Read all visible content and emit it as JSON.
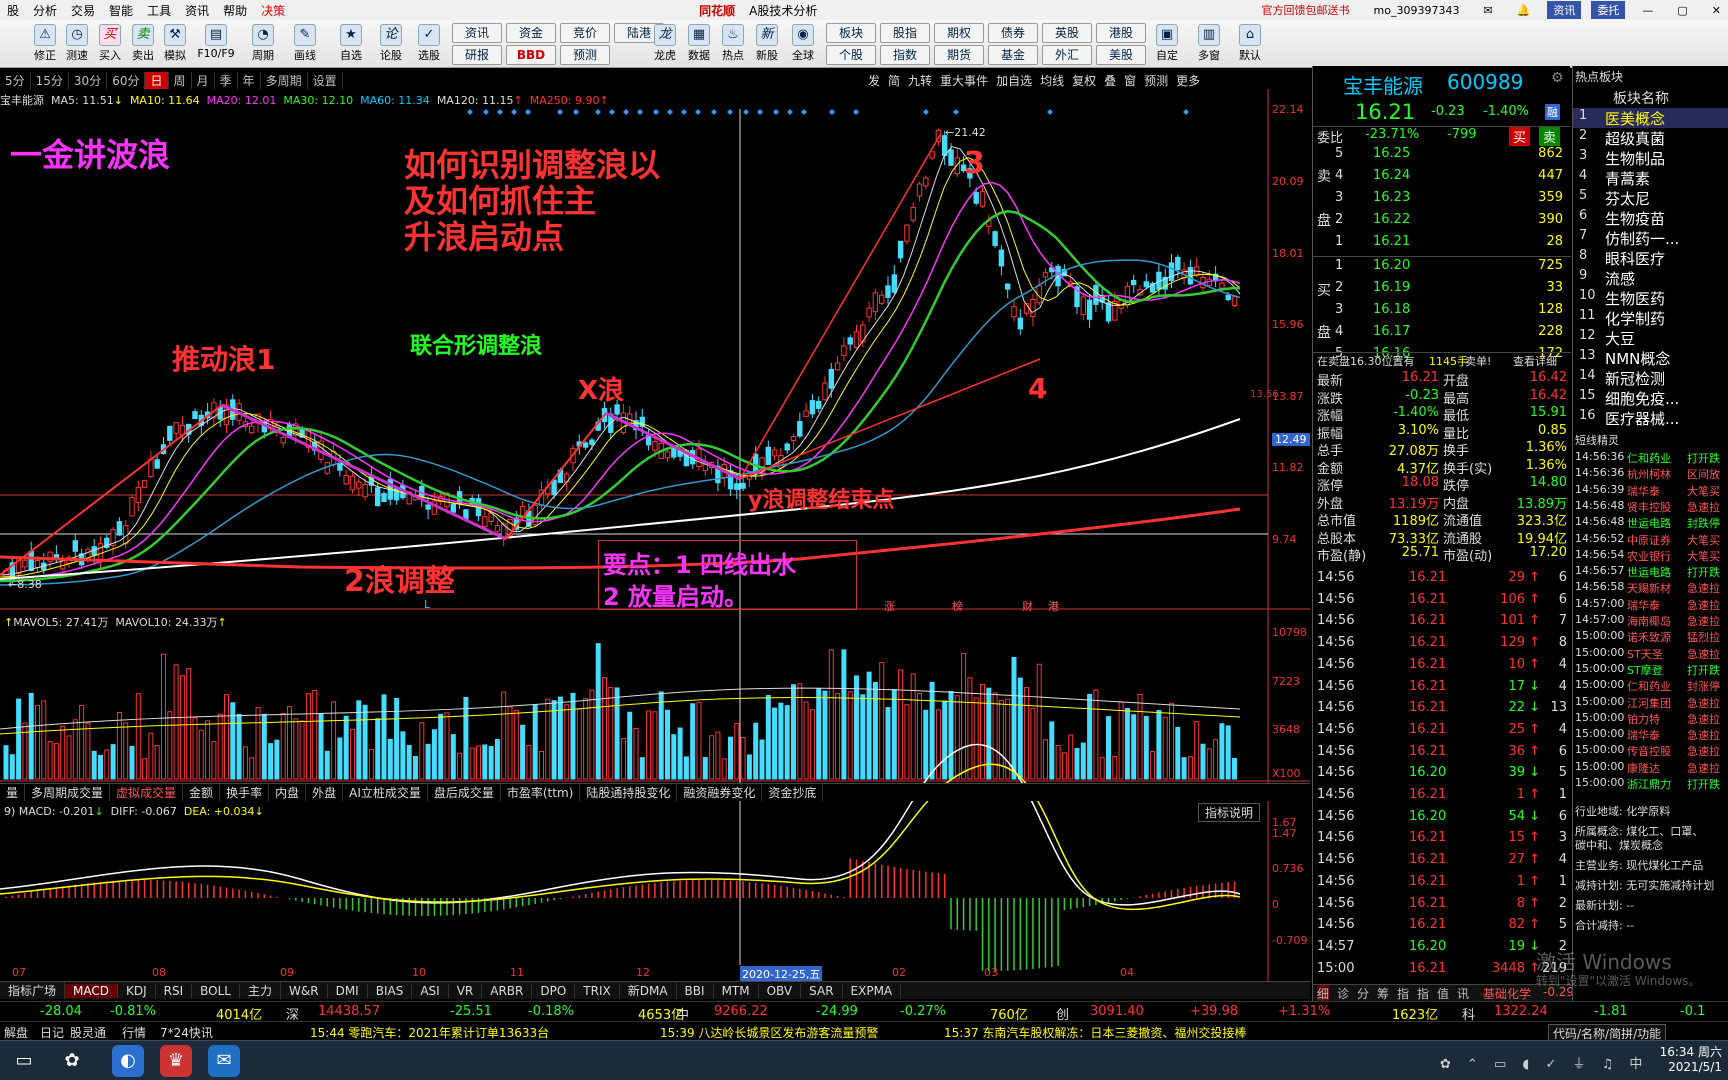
{
  "menu": {
    "items": [
      "股",
      "分析",
      "交易",
      "智能",
      "工具",
      "资讯",
      "帮助",
      "决策"
    ],
    "logo": "同花顺",
    "app_title": "A股技术分析",
    "promo": "官方回馈包邮送书",
    "user": "mo_309397343",
    "zixun": "资讯",
    "weituo": "委托"
  },
  "toolbar": {
    "icons": [
      "修正",
      "测速",
      "买入",
      "卖出",
      "模拟",
      "F10/F9",
      "周期",
      "画线",
      "自选",
      "论股",
      "选股"
    ],
    "grid1": [
      "资讯",
      "资金",
      "竞价",
      "陆港",
      "研报",
      "BBD",
      "预测"
    ],
    "icons2": [
      "龙虎",
      "数据",
      "热点",
      "新股",
      "全球"
    ],
    "grid2": [
      "板块",
      "股指",
      "期权",
      "债券",
      "英股",
      "港股",
      "个股",
      "指数",
      "期货",
      "基金",
      "外汇",
      "美股"
    ],
    "icons3": [
      "自定",
      "多窗",
      "默认"
    ]
  },
  "periods": [
    "5分",
    "15分",
    "30分",
    "60分",
    "日",
    "周",
    "月",
    "季",
    "年",
    "多周期",
    "设置"
  ],
  "period_selected": "日",
  "chart_tools": [
    "发",
    "简",
    "九转",
    "重大事件",
    "加自选",
    "均线",
    "复权",
    "叠",
    "窗",
    "预测",
    "更多"
  ],
  "ma": {
    "name": "宝丰能源",
    "ma5": "MA5: 11.51",
    "ma10": "MA10: 11.64",
    "ma20": "MA20: 12.01",
    "ma30": "MA30: 12.10",
    "ma60": "MA60: 11.34",
    "ma120": "MA120: 11.15",
    "ma250": "MA250: 9.90"
  },
  "price_axis": [
    "22.14",
    "20.09",
    "18.01",
    "15.96",
    "13.87",
    "11.82",
    "9.74"
  ],
  "price_tags": {
    "cur": "12.49",
    "line": "13.56",
    "high": "21.42",
    "low": "8.38"
  },
  "annotations": {
    "title": "一金讲波浪",
    "q1": "如何识别调整浪以",
    "q2": "及如何抓住主",
    "q3": "升浪启动点",
    "w1": "推动浪1",
    "w2": "2浪调整",
    "wx": "X浪",
    "combo": "联合形调整浪",
    "w3": "3",
    "w4": "4",
    "end": "y浪调整结束点",
    "kp1": "要点：1 四线出水",
    "kp2": "2 放量启动。",
    "l": "L",
    "marks": [
      "涨",
      "榜",
      "财",
      "港"
    ]
  },
  "vol": {
    "mavol5": "MAVOL5: 27.41万",
    "mavol10": "MAVOL10: 24.33万",
    "axis": [
      "10798",
      "7223",
      "3648",
      "X100"
    ]
  },
  "indicator_tabs": [
    "量",
    "多周期成交量",
    "虚拟成交量",
    "金额",
    "换手率",
    "内盘",
    "外盘",
    "AI立桩成交量",
    "盘后成交量",
    "市盈率(ttm)",
    "陆股通持股变化",
    "融资融券变化",
    "资金抄底"
  ],
  "indicator_selected": "虚拟成交量",
  "macd": {
    "label": "MACD: -0.201",
    "diff": "DIFF: -0.067",
    "dea": "DEA: +0.034",
    "help": "指标说明",
    "axis": [
      "1.67",
      "1.47",
      "0.736",
      "0",
      "-0.709"
    ]
  },
  "date_axis": [
    "07",
    "08",
    "09",
    "10",
    "11",
    "12",
    "2020-12-25,五",
    "02",
    "03",
    "04"
  ],
  "bottom_tabs": [
    "指标广场",
    "MACD",
    "KDJ",
    "RSI",
    "BOLL",
    "主力",
    "W&R",
    "DMI",
    "BIAS",
    "ASI",
    "VR",
    "ARBR",
    "DPO",
    "TRIX",
    "新DMA",
    "BBI",
    "MTM",
    "OBV",
    "SAR",
    "EXPMA"
  ],
  "bottom_selected": "MACD",
  "stock": {
    "name": "宝丰能源",
    "code": "600989",
    "price": "16.21",
    "change": "-0.23",
    "pct": "-1.40%",
    "tag": "融"
  },
  "weibi": {
    "label": "委比",
    "pct": "-23.71%",
    "diff": "-799",
    "sell": "买",
    "buy": "卖"
  },
  "asks": [
    {
      "n": "5",
      "p": "16.25",
      "v": "862"
    },
    {
      "n": "4",
      "p": "16.24",
      "v": "447"
    },
    {
      "n": "3",
      "p": "16.23",
      "v": "359"
    },
    {
      "n": "2",
      "p": "16.22",
      "v": "390"
    },
    {
      "n": "1",
      "p": "16.21",
      "v": "28"
    }
  ],
  "bids": [
    {
      "n": "1",
      "p": "16.20",
      "v": "725"
    },
    {
      "n": "2",
      "p": "16.19",
      "v": "33"
    },
    {
      "n": "3",
      "p": "16.18",
      "v": "128"
    },
    {
      "n": "4",
      "p": "16.17",
      "v": "228"
    },
    {
      "n": "5",
      "p": "16.16",
      "v": "172"
    }
  ],
  "ask_label": [
    "卖",
    "盘"
  ],
  "bid_label": [
    "买",
    "盘"
  ],
  "mid_msg": {
    "t1": "在卖盘16.30位置有",
    "t2": "1145手",
    "t3": "卖单!",
    "t4": "查看详细"
  },
  "stats": [
    [
      "最新",
      "16.21",
      "开盘",
      "16.42"
    ],
    [
      "涨跌",
      "-0.23",
      "最高",
      "16.42"
    ],
    [
      "涨幅",
      "-1.40%",
      "最低",
      "15.91"
    ],
    [
      "振幅",
      "3.10%",
      "量比",
      "0.85"
    ],
    [
      "总手",
      "27.08万",
      "换手",
      "1.36%"
    ],
    [
      "金额",
      "4.37亿",
      "换手(实)",
      "1.36%"
    ],
    [
      "涨停",
      "18.08",
      "跌停",
      "14.80"
    ],
    [
      "外盘",
      "13.19万",
      "内盘",
      "13.89万"
    ],
    [
      "总市值",
      "1189亿",
      "流通值",
      "323.3亿"
    ],
    [
      "总股本",
      "73.33亿",
      "流通股",
      "19.94亿"
    ],
    [
      "市盈(静)",
      "25.71",
      "市盈(动)",
      "17.20"
    ]
  ],
  "ticks": [
    [
      "14:56",
      "16.21",
      "29",
      "↑",
      "6"
    ],
    [
      "14:56",
      "16.21",
      "106",
      "↑",
      "6"
    ],
    [
      "14:56",
      "16.21",
      "101",
      "↑",
      "7"
    ],
    [
      "14:56",
      "16.21",
      "129",
      "↑",
      "8"
    ],
    [
      "14:56",
      "16.21",
      "10",
      "↑",
      "4"
    ],
    [
      "14:56",
      "16.21",
      "17",
      "↓",
      "4"
    ],
    [
      "14:56",
      "16.21",
      "22",
      "↓",
      "13"
    ],
    [
      "14:56",
      "16.21",
      "25",
      "↑",
      "4"
    ],
    [
      "14:56",
      "16.21",
      "36",
      "↑",
      "6"
    ],
    [
      "14:56",
      "16.20",
      "39",
      "↓",
      "5"
    ],
    [
      "14:56",
      "16.21",
      "1",
      "↑",
      "1"
    ],
    [
      "14:56",
      "16.20",
      "54",
      "↓",
      "6"
    ],
    [
      "14:56",
      "16.21",
      "15",
      "↑",
      "3"
    ],
    [
      "14:56",
      "16.21",
      "27",
      "↑",
      "4"
    ],
    [
      "14:56",
      "16.21",
      "1",
      "↑",
      "1"
    ],
    [
      "14:56",
      "16.21",
      "8",
      "↑",
      "2"
    ],
    [
      "14:56",
      "16.21",
      "82",
      "↑",
      "5"
    ],
    [
      "14:57",
      "16.20",
      "19",
      "↓",
      "2"
    ],
    [
      "15:00",
      "16.21",
      "3448",
      "↑",
      "219"
    ]
  ],
  "ticks_footer": [
    "细",
    "诊",
    "分",
    "筹",
    "指",
    "指",
    "值",
    "讯",
    "基础化学",
    "-0.29%"
  ],
  "sector": {
    "header": "热点板块",
    "col": "板块名称",
    "items": [
      "医美概念",
      "超级真菌",
      "生物制品",
      "青蒿素",
      "芬太尼",
      "生物疫苗",
      "仿制药一...",
      "眼科医疗",
      "流感",
      "生物医药",
      "化学制药",
      "大豆",
      "NMN概念",
      "新冠检测",
      "细胞免疫...",
      "医疗器械..."
    ]
  },
  "sprite": {
    "header": "短线精灵",
    "rows": [
      [
        "14:56:36",
        "仁和药业",
        "打开跌"
      ],
      [
        "14:56:36",
        "杭州柯林",
        "区间放"
      ],
      [
        "14:56:39",
        "瑞华泰",
        "大笔买"
      ],
      [
        "14:56:48",
        "贤丰控股",
        "急速拉"
      ],
      [
        "14:56:48",
        "世运电路",
        "封跌停"
      ],
      [
        "14:56:52",
        "中原证券",
        "大笔买"
      ],
      [
        "14:56:54",
        "农业银行",
        "大笔买"
      ],
      [
        "14:56:57",
        "世运电路",
        "打开跌"
      ],
      [
        "14:56:58",
        "天赐新材",
        "急速拉"
      ],
      [
        "14:57:00",
        "瑞华泰",
        "急速拉"
      ],
      [
        "14:57:00",
        "海南椰岛",
        "急速拉"
      ],
      [
        "15:00:00",
        "诺禾致源",
        "猛烈拉"
      ],
      [
        "15:00:00",
        "ST天圣",
        "急速拉"
      ],
      [
        "15:00:00",
        "ST摩登",
        "打开跌"
      ],
      [
        "15:00:00",
        "仁和药业",
        "封涨停"
      ],
      [
        "15:00:00",
        "江河集团",
        "急速拉"
      ],
      [
        "15:00:00",
        "铂力特",
        "急速拉"
      ],
      [
        "15:00:00",
        "瑞华泰",
        "急速拉"
      ],
      [
        "15:00:00",
        "传音控股",
        "急速拉"
      ],
      [
        "15:00:00",
        "康隆达",
        "急速拉"
      ],
      [
        "15:00:00",
        "浙江鼎力",
        "打开跌"
      ]
    ]
  },
  "profile": {
    "region": "行业地域: 化学原料",
    "concept1": "所属概念: 煤化工、口罩、",
    "concept2": "碳中和、煤炭概念",
    "business": "主营业务: 现代煤化工产品",
    "plan": "减持计划: 无可实施减持计划",
    "recent": "最新计划: --",
    "rec2": "合计减持: --"
  },
  "indices": [
    [
      "-28.04",
      "-0.81%",
      "4014亿"
    ],
    [
      "深",
      "14438.57",
      "-25.51",
      "-0.18%",
      "4653亿"
    ],
    [
      "中",
      "9266.22",
      "-24.99",
      "-0.27%",
      "760亿"
    ],
    [
      "创",
      "3091.40",
      "+39.98",
      "+1.31%",
      "1623亿"
    ],
    [
      "科",
      "1322.24",
      "-1.81",
      "-0.1"
    ]
  ],
  "news": [
    "解盘",
    "日记",
    "股灵通",
    "行情",
    "7*24快讯",
    "15:44 零跑汽车：2021年累计订单13633台",
    "15:39 八达岭长城景区发布游客流量预警",
    "15:37 东南汽车股权解冻：日本三菱撤资、福州交投接棒",
    "代码/名称/简拼/功能"
  ],
  "watermark": [
    "激活 Windows",
    "转到\"设置\"以激活 Windows。"
  ],
  "clock": {
    "time": "16:34 周六",
    "date": "2021/5/1"
  }
}
